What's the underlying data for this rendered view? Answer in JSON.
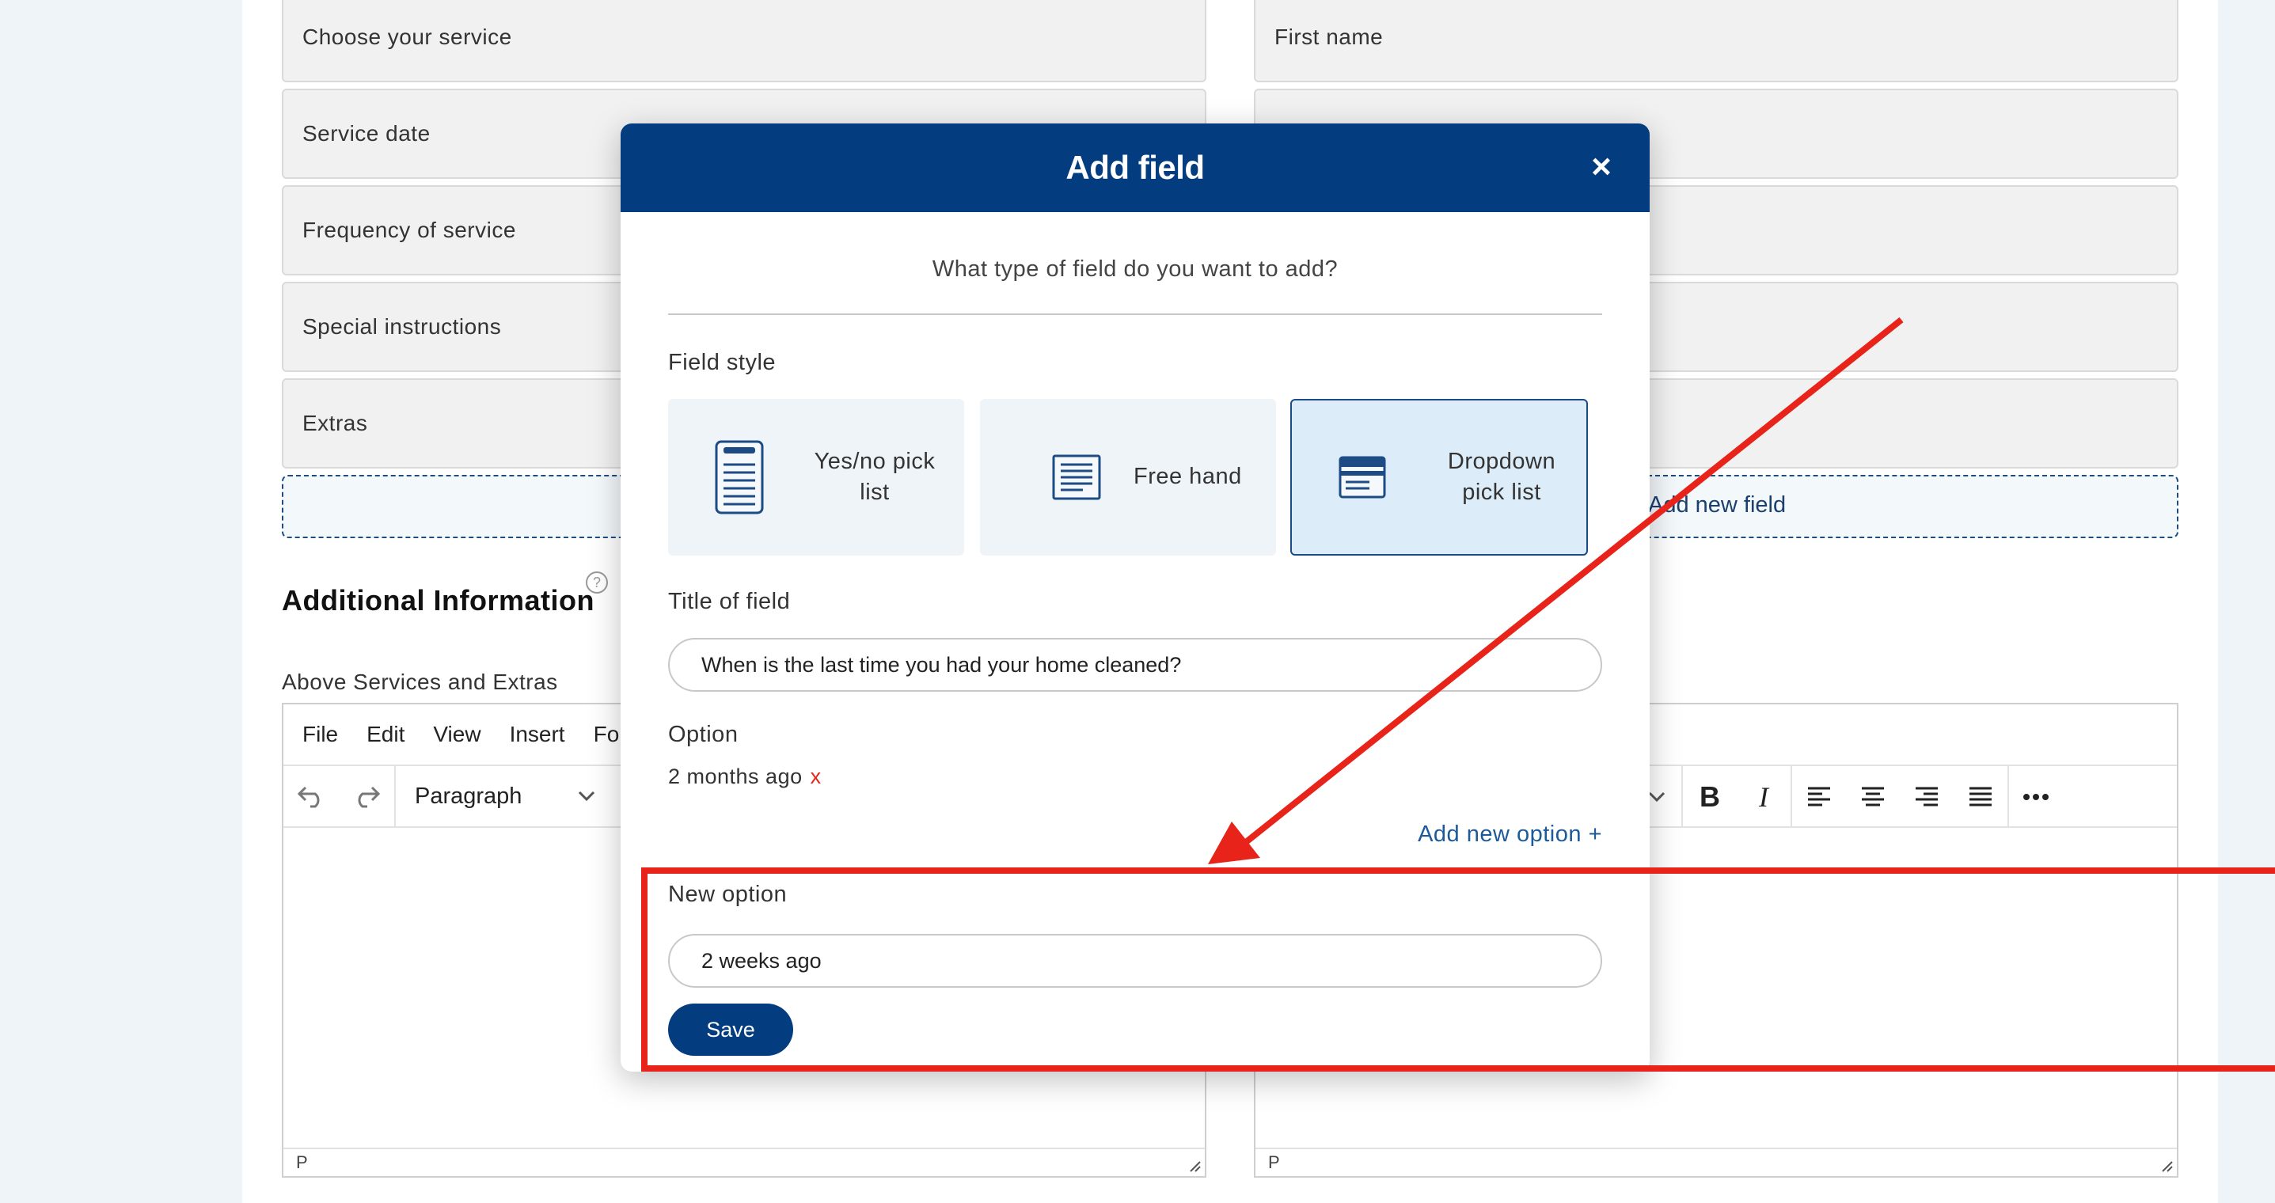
{
  "left_fields": [
    "Choose your service",
    "Service date",
    "Frequency of service",
    "Special instructions",
    "Extras"
  ],
  "right_fields": [
    "First name",
    "",
    "",
    "",
    ""
  ],
  "add_new_field": "Add new field",
  "additional_info": {
    "title": "Additional Information",
    "help": "?",
    "sub_label": "Above Services and Extras"
  },
  "editor_left": {
    "menu": [
      "File",
      "Edit",
      "View",
      "Insert",
      "For"
    ],
    "block_format": "Paragraph",
    "status": "P"
  },
  "editor_right": {
    "status": "P"
  },
  "modal": {
    "title": "Add field",
    "close": "×",
    "question": "What type of field do you want to add?",
    "field_style_label": "Field style",
    "styles": [
      {
        "line1": "Yes/no pick",
        "line2": "list",
        "selected": false,
        "icon": "list-document-icon"
      },
      {
        "line1": "Free hand",
        "line2": "",
        "selected": false,
        "icon": "text-document-icon"
      },
      {
        "line1": "Dropdown",
        "line2": "pick list",
        "selected": true,
        "icon": "dropdown-window-icon"
      }
    ],
    "title_label": "Title of field",
    "title_value": "When is the last time you had your home cleaned?",
    "option_label": "Option",
    "options": [
      {
        "text": "2 months ago",
        "remove": "x"
      }
    ],
    "add_option": "Add new option +",
    "new_option_label": "New option",
    "new_option_value": "2 weeks ago",
    "save": "Save"
  },
  "colors": {
    "brand_navy": "#043d7f",
    "annotation_red": "#e8231a",
    "selected_card_bg": "#dcecf8"
  }
}
